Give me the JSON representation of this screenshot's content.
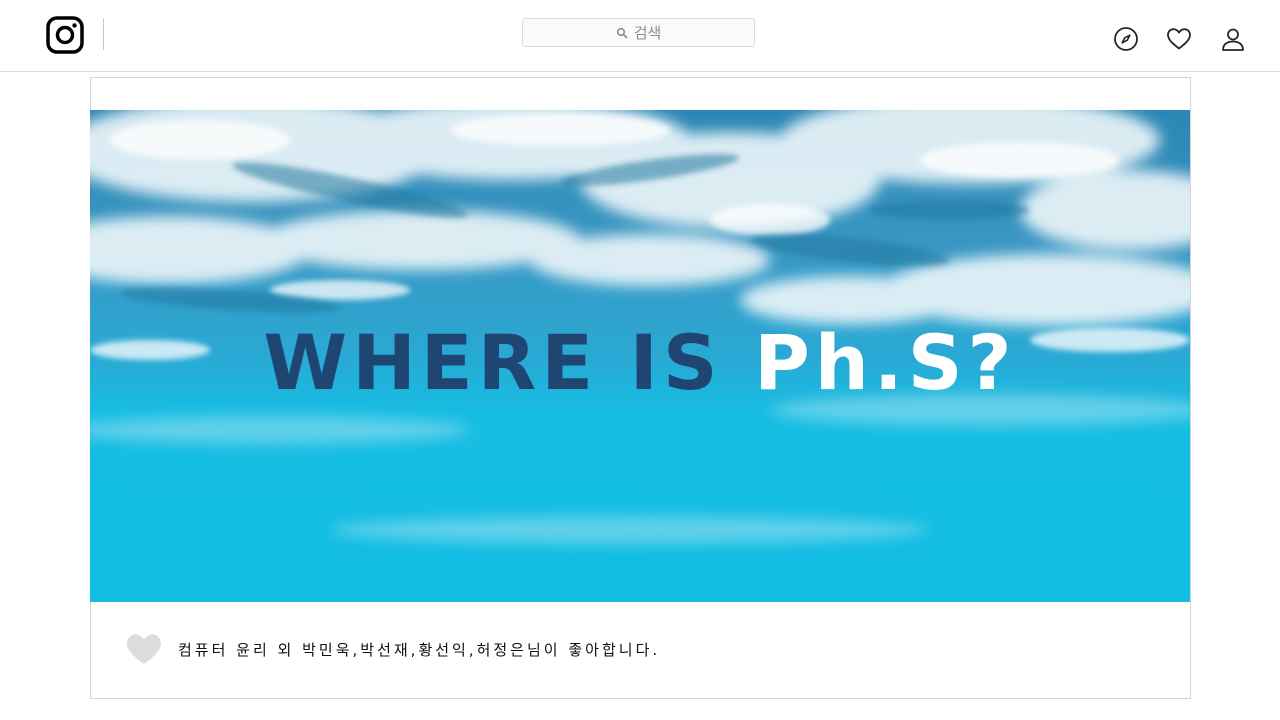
{
  "header": {
    "logo_icon": "instagram-logo-icon",
    "search": {
      "icon": "search-icon",
      "placeholder": "검색"
    },
    "nav_icons": [
      "compass-icon",
      "heart-icon",
      "user-icon"
    ]
  },
  "post": {
    "headline_dark": "WHERE IS ",
    "headline_light": "Ph.S?",
    "likes": {
      "icon": "heart-icon",
      "text": "컴퓨터 윤리 외 박민욱,박선재,황선익,허정은님이 좋아합니다."
    }
  },
  "colors": {
    "headline_dark": "#1f4673",
    "headline_light": "#ffffff",
    "water_surface": "#2f8fbf",
    "water_deep": "#13bfe2",
    "like_heart": "#dcdcdc"
  }
}
